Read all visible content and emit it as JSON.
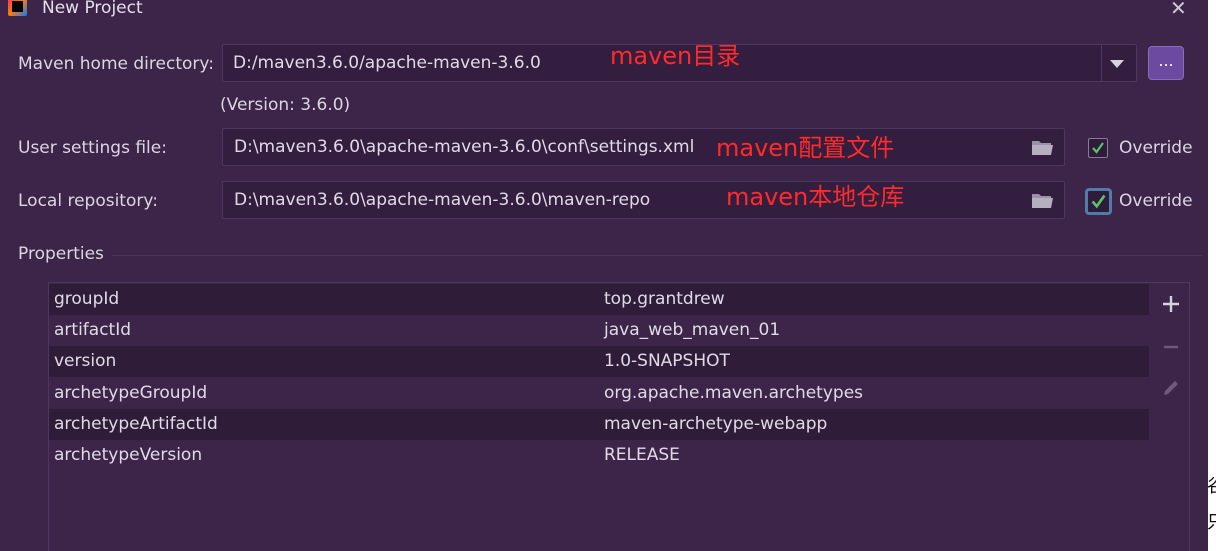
{
  "window": {
    "title": "New Project",
    "close_glyph": "✕"
  },
  "maven_home": {
    "label": "Maven home directory:",
    "value": "D:/maven3.6.0/apache-maven-3.6.0",
    "browse_label": "...",
    "version_text": "(Version: 3.6.0)"
  },
  "user_settings": {
    "label": "User settings file:",
    "value": "D:\\maven3.6.0\\apache-maven-3.6.0\\conf\\settings.xml",
    "override_label": "Override",
    "override_checked": true
  },
  "local_repo": {
    "label": "Local repository:",
    "value": "D:\\maven3.6.0\\apache-maven-3.6.0\\maven-repo",
    "override_label": "Override",
    "override_checked": true
  },
  "annotations": {
    "home": "maven目录",
    "settings": "maven配置文件",
    "repo": "maven本地仓库"
  },
  "properties": {
    "title": "Properties",
    "rows": [
      {
        "key": "groupId",
        "value": "top.grantdrew"
      },
      {
        "key": "artifactId",
        "value": "java_web_maven_01"
      },
      {
        "key": "version",
        "value": "1.0-SNAPSHOT"
      },
      {
        "key": "archetypeGroupId",
        "value": "org.apache.maven.archetypes"
      },
      {
        "key": "archetypeArtifactId",
        "value": "maven-archetype-webapp"
      },
      {
        "key": "archetypeVersion",
        "value": "RELEASE"
      }
    ]
  },
  "toolbar": {
    "add_icon": "plus-icon",
    "remove_icon": "minus-icon",
    "edit_icon": "pencil-icon"
  },
  "colors": {
    "dialog_bg": "#3c2548",
    "field_bg": "#331e3f",
    "annotation": "#ff2a2a",
    "check": "#5cc36a",
    "browse_button": "#6b4aa0"
  },
  "background_window": {
    "glyph_top": "谷",
    "glyph_bottom": "只"
  }
}
